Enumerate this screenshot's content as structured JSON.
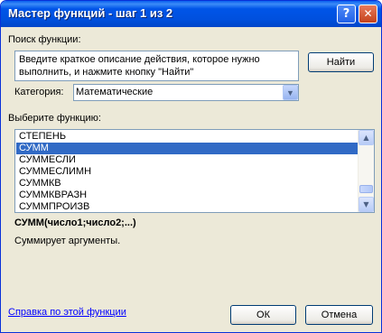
{
  "window": {
    "title": "Мастер функций - шаг 1 из 2",
    "help_glyph": "?",
    "close_glyph": "✕"
  },
  "search": {
    "label": "Поиск функции:",
    "value": "Введите краткое описание действия, которое нужно выполнить, и нажмите кнопку \"Найти\"",
    "find_label": "Найти"
  },
  "category": {
    "label": "Категория:",
    "selected": "Математические"
  },
  "function_list": {
    "label": "Выберите функцию:",
    "items": [
      "СТЕПЕНЬ",
      "СУММ",
      "СУММЕСЛИ",
      "СУММЕСЛИМН",
      "СУММКВ",
      "СУММКВРАЗН",
      "СУММПРОИЗВ"
    ],
    "selected_index": 1
  },
  "function_info": {
    "signature": "СУММ(число1;число2;...)",
    "description": "Суммирует аргументы."
  },
  "footer": {
    "help_link": "Справка по этой функции",
    "ok_label": "ОК",
    "cancel_label": "Отмена"
  },
  "colors": {
    "titlebar": "#0055E8",
    "selection": "#316AC5",
    "dialog_bg": "#ECE9D8",
    "link": "#0000FF"
  }
}
